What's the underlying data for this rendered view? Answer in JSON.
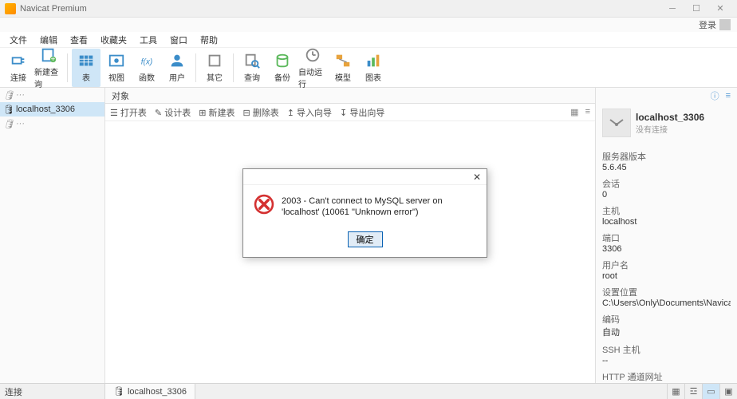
{
  "titlebar": {
    "title": "Navicat Premium"
  },
  "login": {
    "label": "登录"
  },
  "menu": {
    "items": [
      "文件",
      "编辑",
      "查看",
      "收藏夹",
      "工具",
      "窗口",
      "帮助"
    ]
  },
  "toolbar": {
    "items": [
      {
        "label": "连接",
        "icon": "plug"
      },
      {
        "label": "新建查询",
        "icon": "query"
      },
      {
        "label": "表",
        "icon": "table",
        "active": true
      },
      {
        "label": "视图",
        "icon": "view"
      },
      {
        "label": "函数",
        "icon": "fx"
      },
      {
        "label": "用户",
        "icon": "user"
      },
      {
        "label": "其它",
        "icon": "other"
      },
      {
        "label": "查询",
        "icon": "search"
      },
      {
        "label": "备份",
        "icon": "backup"
      },
      {
        "label": "自动运行",
        "icon": "auto"
      },
      {
        "label": "模型",
        "icon": "model"
      },
      {
        "label": "图表",
        "icon": "chart"
      }
    ]
  },
  "connections": {
    "items": [
      {
        "label": "···",
        "gray": true
      },
      {
        "label": "localhost_3306",
        "selected": true
      },
      {
        "label": "···",
        "gray": true
      }
    ]
  },
  "object_header": {
    "label": "对象"
  },
  "object_toolbar": {
    "items": [
      "打开表",
      "设计表",
      "新建表",
      "删除表",
      "导入向导",
      "导出向导"
    ]
  },
  "right_panel": {
    "title": "localhost_3306",
    "sub": "没有连接",
    "props": [
      {
        "label": "服务器版本",
        "value": "5.6.45"
      },
      {
        "label": "会话",
        "value": "0"
      },
      {
        "label": "主机",
        "value": "localhost"
      },
      {
        "label": "端口",
        "value": "3306"
      },
      {
        "label": "用户名",
        "value": "root"
      },
      {
        "label": "设置位置",
        "value": "C:\\Users\\Only\\Documents\\Navicat\\MySQL\\Serv"
      },
      {
        "label": "编码",
        "value": "自动"
      },
      {
        "label": "SSH 主机",
        "value": "--"
      },
      {
        "label": "HTTP 通道网址",
        "value": "--"
      }
    ]
  },
  "dialog": {
    "message": "2003 - Can't connect to MySQL server on 'localhost' (10061 \"Unknown error\")",
    "ok": "确定"
  },
  "statusbar": {
    "left": "连接",
    "tab": "localhost_3306"
  }
}
